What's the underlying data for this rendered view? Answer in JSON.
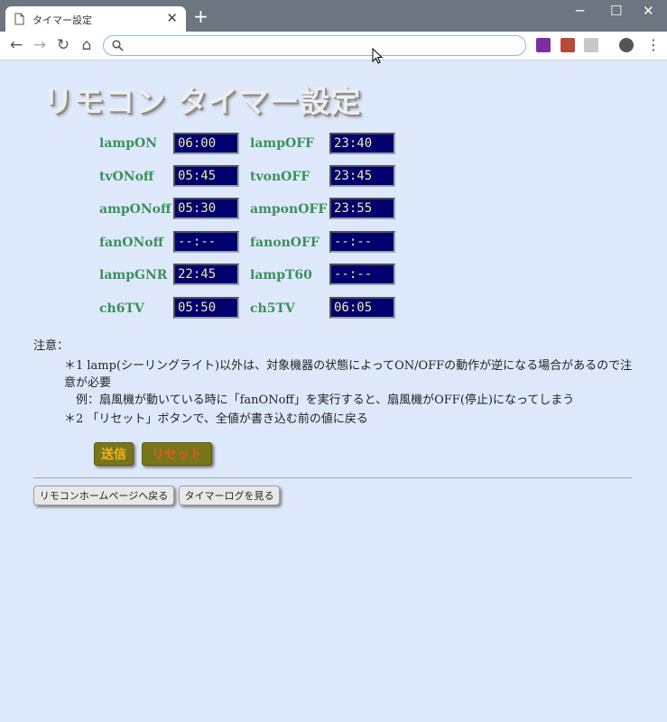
{
  "browser": {
    "tab_title": "タイマー設定",
    "tab_close": "✕",
    "new_tab": "+",
    "window_controls": {
      "minimize": "─",
      "maximize": "☐",
      "close": "✕"
    },
    "nav": {
      "back": "←",
      "forward": "→",
      "reload": "↻",
      "home": "⌂"
    },
    "address": {
      "value": "",
      "placeholder": ""
    },
    "menu": "⋮",
    "icons": [
      "page-icon",
      "search-icon",
      "onenote-icon",
      "pdf-icon",
      "extension-icon",
      "profile-icon",
      "cursor-icon"
    ]
  },
  "page": {
    "title": "リモコン タイマー設定",
    "timers": [
      {
        "label": "lampON",
        "value": "06:00"
      },
      {
        "label": "lampOFF",
        "value": "23:40"
      },
      {
        "label": "tvONoff",
        "value": "05:45"
      },
      {
        "label": "tvonOFF",
        "value": "23:45"
      },
      {
        "label": "ampONoff",
        "value": "05:30"
      },
      {
        "label": "amponOFF",
        "value": "23:55"
      },
      {
        "label": "fanONoff",
        "value": "--:--"
      },
      {
        "label": "fanonOFF",
        "value": "--:--"
      },
      {
        "label": "lampGNR",
        "value": "22:45"
      },
      {
        "label": "lampT60",
        "value": "--:--"
      },
      {
        "label": "ch6TV",
        "value": "05:50"
      },
      {
        "label": "ch5TV",
        "value": "06:05"
      }
    ],
    "notes": {
      "heading": "注意：",
      "note1": "＊1 lamp(シーリングライト)以外は、対象機器の状態によってON/OFFの動作が逆になる場合があるので注意が必要",
      "example": "例：扇風機が動いている時に「fanONoff」を実行すると、扇風機がOFF(停止)になってしまう",
      "note2": "＊2 「リセット」ボタンで、全値が書き込む前の値に戻る"
    },
    "buttons": {
      "send": "送信",
      "reset": "リセット",
      "home": "リモコンホームページへ戻る",
      "log": "タイマーログを見る"
    }
  },
  "colors": {
    "page_bg": "#dde9fb",
    "label_green": "#3e8f5c",
    "input_bg": "#00006e",
    "input_text": "#f2e9a8",
    "button_olive": "#77761a",
    "send_text": "#f7b021",
    "reset_text": "#e85a18"
  }
}
